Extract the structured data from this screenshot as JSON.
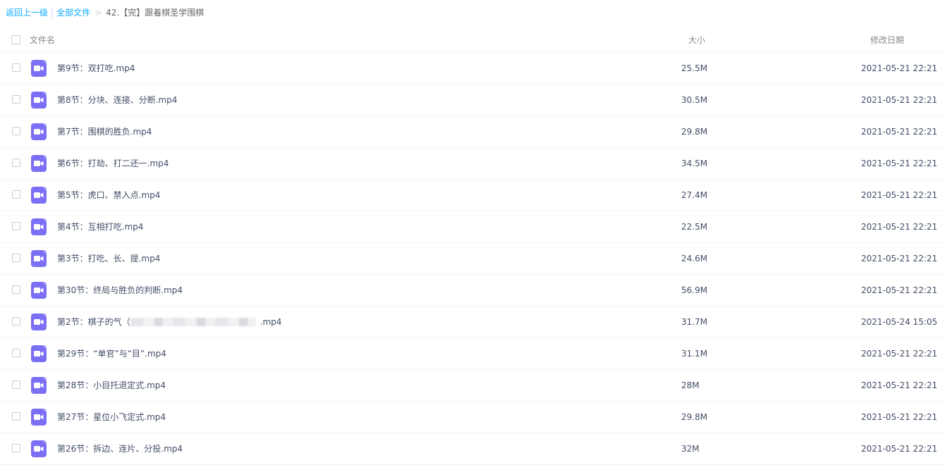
{
  "breadcrumb": {
    "back": "返回上一级",
    "all": "全部文件",
    "current": "42.【完】跟着棋圣学围棋"
  },
  "header": {
    "name": "文件名",
    "size": "大小",
    "date": "修改日期"
  },
  "files": [
    {
      "name": "第9节：双打吃.mp4",
      "size": "25.5M",
      "date": "2021-05-21 22:21"
    },
    {
      "name": "第8节：分块、连接、分断.mp4",
      "size": "30.5M",
      "date": "2021-05-21 22:21"
    },
    {
      "name": "第7节：围棋的胜负.mp4",
      "size": "29.8M",
      "date": "2021-05-21 22:21"
    },
    {
      "name": "第6节：打劫、打二还一.mp4",
      "size": "34.5M",
      "date": "2021-05-21 22:21"
    },
    {
      "name": "第5节：虎口、禁入点.mp4",
      "size": "27.4M",
      "date": "2021-05-21 22:21"
    },
    {
      "name": "第4节：互相打吃.mp4",
      "size": "22.5M",
      "date": "2021-05-21 22:21"
    },
    {
      "name": "第3节：打吃、长、提.mp4",
      "size": "24.6M",
      "date": "2021-05-21 22:21"
    },
    {
      "name": "第30节：终局与胜负的判断.mp4",
      "size": "56.9M",
      "date": "2021-05-21 22:21"
    },
    {
      "name": "第2节：棋子的气（",
      "name_suffix": ".mp4",
      "redacted": true,
      "size": "31.7M",
      "date": "2021-05-24 15:05"
    },
    {
      "name": "第29节：“单官”与“目”.mp4",
      "size": "31.1M",
      "date": "2021-05-21 22:21"
    },
    {
      "name": "第28节：小目托退定式.mp4",
      "size": "28M",
      "date": "2021-05-21 22:21"
    },
    {
      "name": "第27节：星位小飞定式.mp4",
      "size": "29.8M",
      "date": "2021-05-21 22:21"
    },
    {
      "name": "第26节：拆边、连片、分投.mp4",
      "size": "32M",
      "date": "2021-05-21 22:21"
    }
  ],
  "colors": {
    "link": "#09aaff",
    "video_icon": "#7b6ff5"
  },
  "icons": {
    "file": "video-file-icon"
  }
}
